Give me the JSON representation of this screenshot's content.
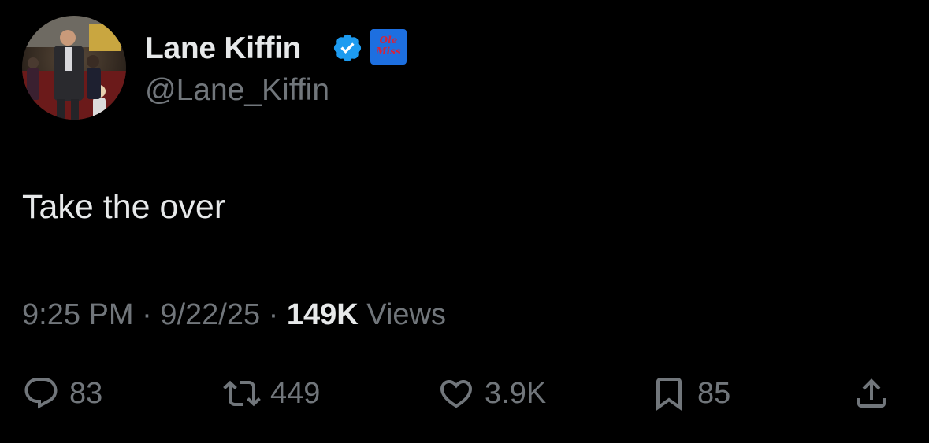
{
  "author": {
    "name": "Lane Kiffin",
    "handle": "@Lane_Kiffin",
    "verified_icon": "verified-badge-icon",
    "affiliate_badge_text": "Ole\nMiss",
    "affiliate_badge_color": "#1d6fe0"
  },
  "tweet": {
    "text": "Take the over",
    "time": "9:25 PM",
    "separator": "·",
    "date": "9/22/25",
    "views_count": "149K",
    "views_label": "Views"
  },
  "actions": {
    "reply": {
      "icon": "reply-icon",
      "count": "83"
    },
    "retweet": {
      "icon": "retweet-icon",
      "count": "449"
    },
    "like": {
      "icon": "heart-icon",
      "count": "3.9K"
    },
    "bookmark": {
      "icon": "bookmark-icon",
      "count": "85"
    },
    "share": {
      "icon": "share-icon"
    }
  },
  "colors": {
    "background": "#000000",
    "primary_text": "#e7e9ea",
    "secondary_text": "#71767b",
    "verified_blue": "#1d9bf0"
  }
}
